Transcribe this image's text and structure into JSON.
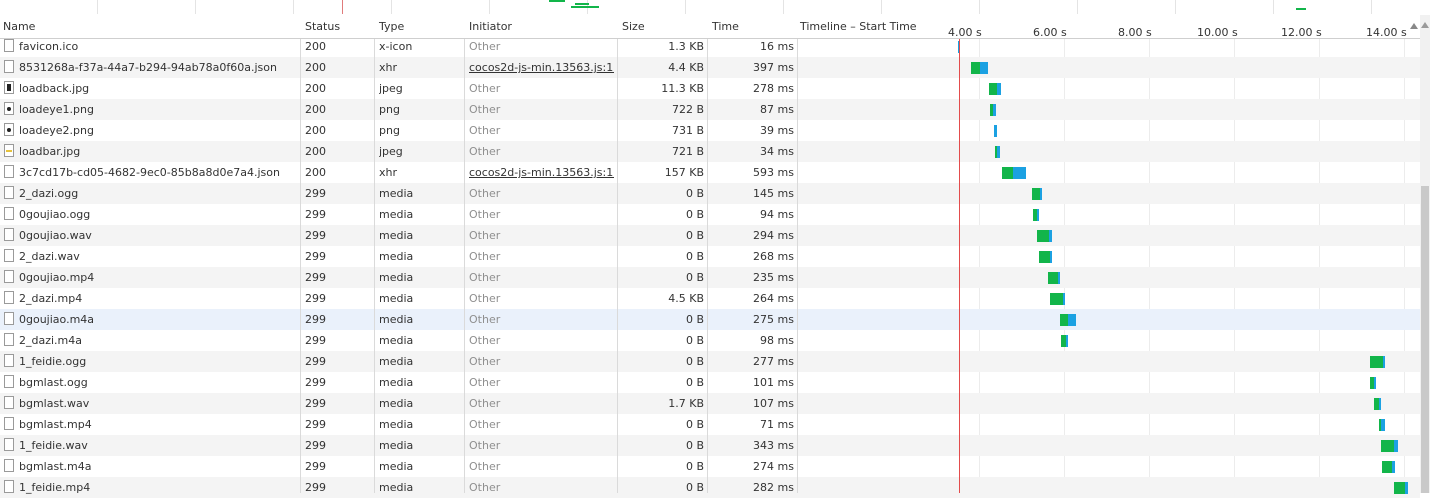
{
  "header": {
    "name": "Name",
    "status": "Status",
    "type": "Type",
    "initiator": "Initiator",
    "size": "Size",
    "time": "Time",
    "timeline": "Timeline – Start Time"
  },
  "timeline_ticks": [
    "4.00 s",
    "6.00 s",
    "8.00 s",
    "10.00 s",
    "12.00 s",
    "14.00 s"
  ],
  "colors": {
    "waiting": "#12b54a",
    "receiving": "#1ba1e2",
    "marker": "#e34c4c"
  },
  "rows": [
    {
      "name": "favicon.ico",
      "status": "200",
      "type": "x-icon",
      "initiator": "Other",
      "size": "1.3 KB",
      "time": "16 ms",
      "icon": "file-icon",
      "bar": {
        "start": 3.95,
        "wait": 0.0,
        "recv": 0.05
      }
    },
    {
      "name": "8531268a-f37a-44a7-b294-94ab78a0f60a.json",
      "status": "200",
      "type": "xhr",
      "initiator": "cocos2d-js-min.13563.js:17",
      "size": "4.4 KB",
      "time": "397 ms",
      "icon": "file-icon",
      "bar": {
        "start": 4.27,
        "wait": 0.2,
        "recv": 0.2
      }
    },
    {
      "name": "loadback.jpg",
      "status": "200",
      "type": "jpeg",
      "initiator": "Other",
      "size": "11.3 KB",
      "time": "278 ms",
      "icon": "image-icon",
      "bar": {
        "start": 4.68,
        "wait": 0.2,
        "recv": 0.08
      }
    },
    {
      "name": "loadeye1.png",
      "status": "200",
      "type": "png",
      "initiator": "Other",
      "size": "722 B",
      "time": "87 ms",
      "icon": "image-icon",
      "bar": {
        "start": 4.71,
        "wait": 0.06,
        "recv": 0.07
      }
    },
    {
      "name": "loadeye2.png",
      "status": "200",
      "type": "png",
      "initiator": "Other",
      "size": "731 B",
      "time": "39 ms",
      "icon": "image-icon",
      "bar": {
        "start": 4.79,
        "wait": 0.0,
        "recv": 0.08
      }
    },
    {
      "name": "loadbar.jpg",
      "status": "200",
      "type": "jpeg",
      "initiator": "Other",
      "size": "721 B",
      "time": "34 ms",
      "icon": "image-icon",
      "bar": {
        "start": 4.82,
        "wait": 0.06,
        "recv": 0.06
      }
    },
    {
      "name": "3c7cd17b-cd05-4682-9ec0-85b8a8d0e7a4.json",
      "status": "200",
      "type": "xhr",
      "initiator": "cocos2d-js-min.13563.js:17",
      "size": "157 KB",
      "time": "593 ms",
      "icon": "file-icon",
      "bar": {
        "start": 4.98,
        "wait": 0.27,
        "recv": 0.31
      }
    },
    {
      "name": "2_dazi.ogg",
      "status": "299",
      "type": "media",
      "initiator": "Other",
      "size": "0 B",
      "time": "145 ms",
      "icon": "file-icon",
      "bar": {
        "start": 5.7,
        "wait": 0.18,
        "recv": 0.06
      }
    },
    {
      "name": "0goujiao.ogg",
      "status": "299",
      "type": "media",
      "initiator": "Other",
      "size": "0 B",
      "time": "94 ms",
      "icon": "file-icon",
      "bar": {
        "start": 5.72,
        "wait": 0.1,
        "recv": 0.04
      }
    },
    {
      "name": "0goujiao.wav",
      "status": "299",
      "type": "media",
      "initiator": "Other",
      "size": "0 B",
      "time": "294 ms",
      "icon": "file-icon",
      "bar": {
        "start": 5.8,
        "wait": 0.3,
        "recv": 0.06
      }
    },
    {
      "name": "2_dazi.wav",
      "status": "299",
      "type": "media",
      "initiator": "Other",
      "size": "0 B",
      "time": "268 ms",
      "icon": "file-icon",
      "bar": {
        "start": 5.85,
        "wait": 0.27,
        "recv": 0.04
      }
    },
    {
      "name": "0goujiao.mp4",
      "status": "299",
      "type": "media",
      "initiator": "Other",
      "size": "0 B",
      "time": "235 ms",
      "icon": "file-icon",
      "bar": {
        "start": 6.08,
        "wait": 0.22,
        "recv": 0.06
      }
    },
    {
      "name": "2_dazi.mp4",
      "status": "299",
      "type": "media",
      "initiator": "Other",
      "size": "4.5 KB",
      "time": "264 ms",
      "icon": "file-icon",
      "bar": {
        "start": 6.12,
        "wait": 0.3,
        "recv": 0.04
      }
    },
    {
      "name": "0goujiao.m4a",
      "status": "299",
      "type": "media",
      "initiator": "Other",
      "size": "0 B",
      "time": "275 ms",
      "icon": "file-icon",
      "bar": {
        "start": 6.35,
        "wait": 0.18,
        "recv": 0.2
      }
    },
    {
      "name": "2_dazi.m4a",
      "status": "299",
      "type": "media",
      "initiator": "Other",
      "size": "0 B",
      "time": "98 ms",
      "icon": "file-icon",
      "bar": {
        "start": 6.38,
        "wait": 0.12,
        "recv": 0.05
      }
    },
    {
      "name": "1_feidie.ogg",
      "status": "299",
      "type": "media",
      "initiator": "Other",
      "size": "0 B",
      "time": "277 ms",
      "icon": "file-icon",
      "bar": {
        "start": 13.65,
        "wait": 0.3,
        "recv": 0.04
      }
    },
    {
      "name": "bgmlast.ogg",
      "status": "299",
      "type": "media",
      "initiator": "Other",
      "size": "0 B",
      "time": "101 ms",
      "icon": "file-icon",
      "bar": {
        "start": 13.65,
        "wait": 0.1,
        "recv": 0.04
      }
    },
    {
      "name": "bgmlast.wav",
      "status": "299",
      "type": "media",
      "initiator": "Other",
      "size": "1.7 KB",
      "time": "107 ms",
      "icon": "file-icon",
      "bar": {
        "start": 13.75,
        "wait": 0.1,
        "recv": 0.05
      }
    },
    {
      "name": "bgmlast.mp4",
      "status": "299",
      "type": "media",
      "initiator": "Other",
      "size": "0 B",
      "time": "71 ms",
      "icon": "file-icon",
      "bar": {
        "start": 13.85,
        "wait": 0.06,
        "recv": 0.08
      }
    },
    {
      "name": "1_feidie.wav",
      "status": "299",
      "type": "media",
      "initiator": "Other",
      "size": "0 B",
      "time": "343 ms",
      "icon": "file-icon",
      "bar": {
        "start": 13.9,
        "wait": 0.3,
        "recv": 0.1
      }
    },
    {
      "name": "bgmlast.m4a",
      "status": "299",
      "type": "media",
      "initiator": "Other",
      "size": "0 B",
      "time": "274 ms",
      "icon": "file-icon",
      "bar": {
        "start": 13.92,
        "wait": 0.24,
        "recv": 0.08
      }
    },
    {
      "name": "1_feidie.mp4",
      "status": "299",
      "type": "media",
      "initiator": "Other",
      "size": "0 B",
      "time": "282 ms",
      "icon": "file-icon",
      "bar": {
        "start": 14.2,
        "wait": 0.27,
        "recv": 0.08
      }
    }
  ]
}
